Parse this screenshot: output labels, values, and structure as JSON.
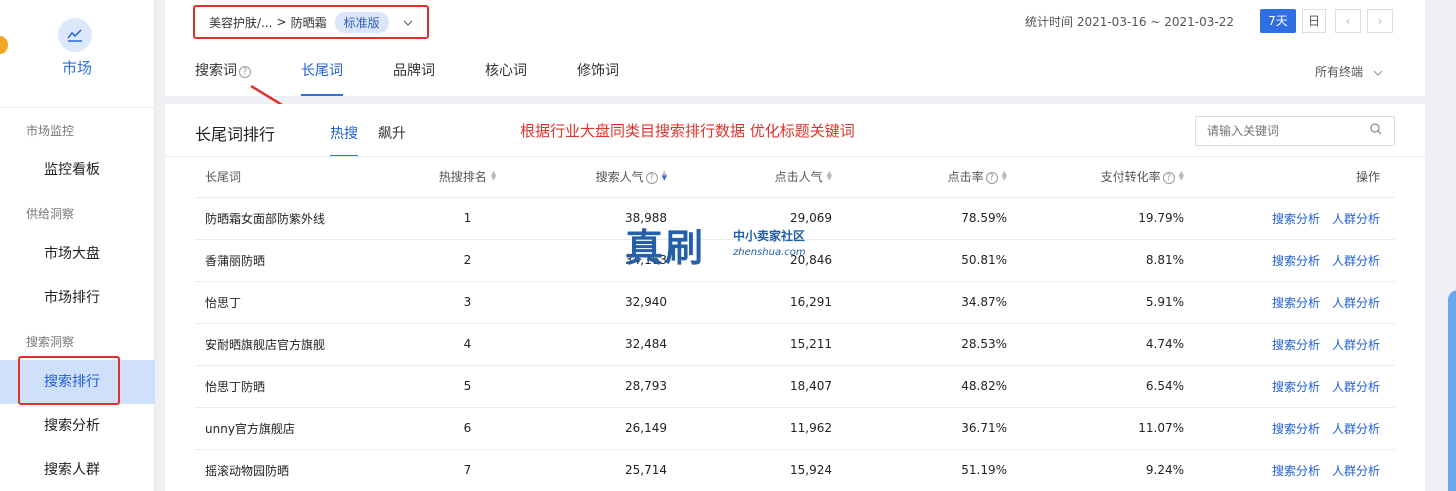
{
  "sidebar": {
    "title": "市场",
    "groups": [
      {
        "label": "市场监控",
        "items": [
          "监控看板"
        ]
      },
      {
        "label": "供给洞察",
        "items": [
          "市场大盘",
          "市场排行"
        ]
      },
      {
        "label": "搜索洞察",
        "items": [
          "搜索排行",
          "搜索分析",
          "搜索人群"
        ]
      }
    ],
    "active": "搜索排行"
  },
  "header": {
    "breadcrumb": [
      "美容护肤/...",
      "防晒霜"
    ],
    "breadcrumb_sep": ">",
    "edition": "标准版",
    "stat_time": "统计时间 2021-03-16 ~ 2021-03-22",
    "range_buttons": [
      "7天",
      "日"
    ],
    "tabs": [
      "搜索词",
      "长尾词",
      "品牌词",
      "核心词",
      "修饰词"
    ],
    "active_tab": "长尾词",
    "terminal": "所有终端"
  },
  "panel": {
    "title": "长尾词排行",
    "subtabs": [
      "热搜",
      "飙升"
    ],
    "annotation": "根据行业大盘同类目搜索排行数据 优化标题关键词",
    "search_placeholder": "请输入关键词",
    "columns": [
      "长尾词",
      "热搜排名",
      "搜索人气",
      "点击人气",
      "点击率",
      "支付转化率",
      "操作"
    ],
    "rows": [
      {
        "word": "防晒霜女面部防紫外线",
        "rank": "1",
        "search": "38,988",
        "click": "29,069",
        "ctr": "78.59%",
        "cvr": "19.79%"
      },
      {
        "word": "香蒲丽防晒",
        "rank": "2",
        "search": "34,163",
        "click": "20,846",
        "ctr": "50.81%",
        "cvr": "8.81%"
      },
      {
        "word": "怡思丁",
        "rank": "3",
        "search": "32,940",
        "click": "16,291",
        "ctr": "34.87%",
        "cvr": "5.91%"
      },
      {
        "word": "安耐晒旗舰店官方旗舰",
        "rank": "4",
        "search": "32,484",
        "click": "15,211",
        "ctr": "28.53%",
        "cvr": "4.74%"
      },
      {
        "word": "怡思丁防晒",
        "rank": "5",
        "search": "28,793",
        "click": "18,407",
        "ctr": "48.82%",
        "cvr": "6.54%"
      },
      {
        "word": "unny官方旗舰店",
        "rank": "6",
        "search": "26,149",
        "click": "11,962",
        "ctr": "36.71%",
        "cvr": "11.07%"
      },
      {
        "word": "摇滚动物园防晒",
        "rank": "7",
        "search": "25,714",
        "click": "15,924",
        "ctr": "51.19%",
        "cvr": "9.24%"
      }
    ],
    "actions": [
      "搜索分析",
      "人群分析"
    ]
  },
  "watermark": {
    "big": "真刷",
    "small": "中小卖家社区",
    "url": "zhenshua.com"
  },
  "colors": {
    "accent": "#2f6fe0",
    "annotation": "#e0322a",
    "active_bg": "#cfe0fb"
  }
}
